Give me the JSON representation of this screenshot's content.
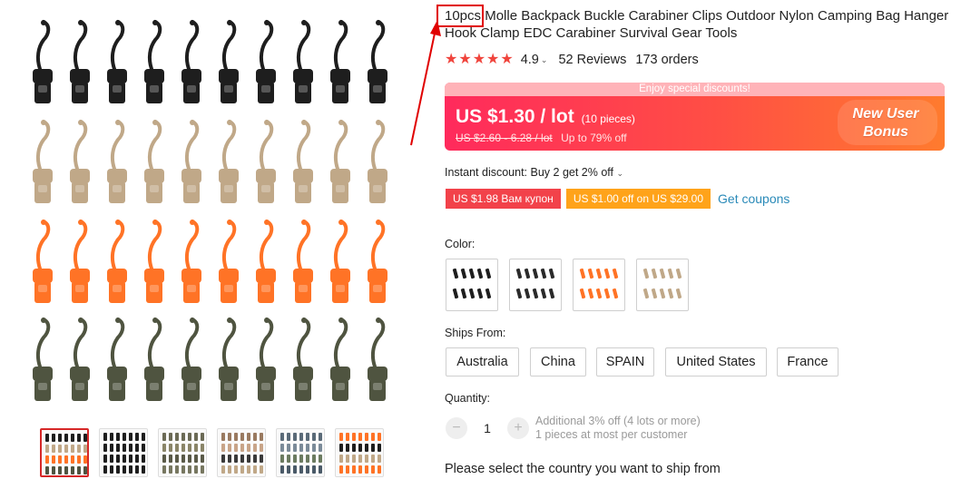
{
  "product": {
    "title": "10pcs Molle Backpack Buckle Carabiner Clips Outdoor Nylon Camping Bag Hanger Hook Clamp EDC Carabiner Survival Gear Tools",
    "rating": "4.9",
    "reviews": "52 Reviews",
    "orders": "173 orders"
  },
  "gallery": {
    "main_image_alt": "main-product-image",
    "rows": [
      {
        "color": "#1e1e1e"
      },
      {
        "color": "#c0a888"
      },
      {
        "color": "#ff7326"
      },
      {
        "color": "#4f5440"
      }
    ],
    "thumbnails": [
      {
        "name": "thumb-mixed",
        "active": true
      },
      {
        "name": "thumb-black",
        "active": false
      },
      {
        "name": "thumb-camo",
        "active": false
      },
      {
        "name": "thumb-hand",
        "active": false
      },
      {
        "name": "thumb-backpack",
        "active": false
      },
      {
        "name": "thumb-variants",
        "active": false
      }
    ]
  },
  "promo": {
    "banner_text": "Enjoy special discounts!",
    "price": "US $1.30 / lot",
    "price_note": "(10 pieces)",
    "original_price": "US $2.60 - 6.28 / lot",
    "discount": "Up to 79% off",
    "new_user_line1": "New User",
    "new_user_line2": "Bonus"
  },
  "instant_discount": "Instant discount: Buy 2 get 2% off",
  "coupons": {
    "coupon1": "US $1.98 Вам купон",
    "coupon2": "US $1.00 off on US $29.00",
    "get_coupons": "Get coupons"
  },
  "color": {
    "label": "Color:",
    "options": [
      {
        "name": "black",
        "hex": "#1e1e1e"
      },
      {
        "name": "black-2",
        "hex": "#2a2a2a"
      },
      {
        "name": "orange",
        "hex": "#ff7326"
      },
      {
        "name": "tan",
        "hex": "#c0a888"
      }
    ]
  },
  "ships_from": {
    "label": "Ships From:",
    "options": [
      "Australia",
      "China",
      "SPAIN",
      "United States",
      "France"
    ]
  },
  "quantity": {
    "label": "Quantity:",
    "value": "1",
    "minus": "−",
    "plus": "+",
    "note1": "Additional 3% off (4 lots or more)",
    "note2": "1 pieces at most per customer"
  },
  "ship_message": "Please select the country you want to ship from",
  "colors": {
    "accent": "#f0443c",
    "annotation": "#e00000",
    "link": "#2a8ab8"
  }
}
